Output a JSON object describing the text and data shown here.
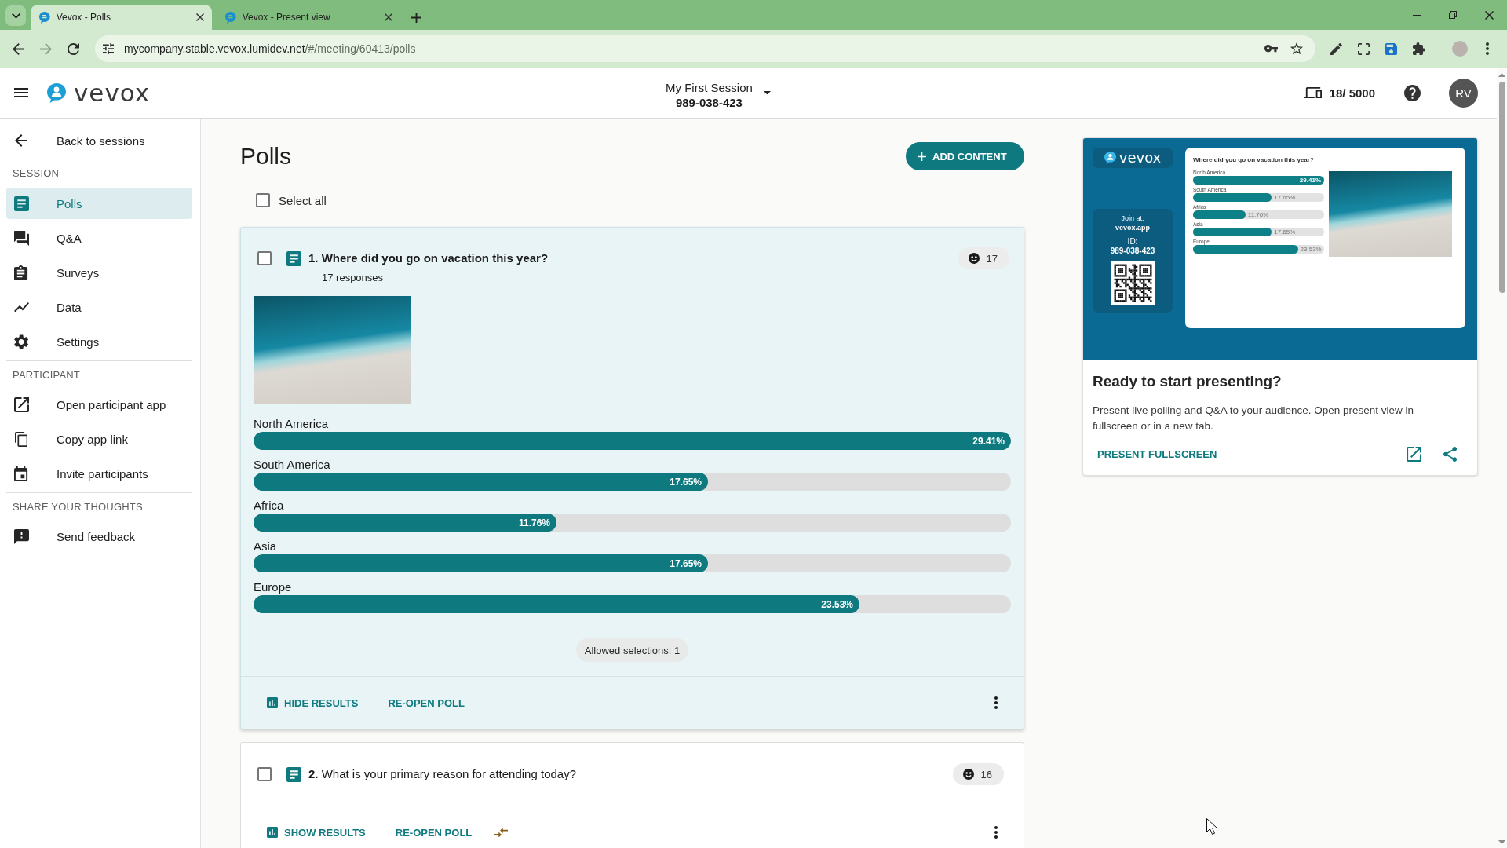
{
  "browser": {
    "tabs": [
      {
        "title": "Vevox - Polls",
        "selected": true
      },
      {
        "title": "Vevox - Present view",
        "selected": false
      }
    ],
    "address": {
      "host": "mycompany.stable.vevox.lumidev.net",
      "path": "/#/meeting/60413/polls"
    }
  },
  "header": {
    "logo": "vevox",
    "session_title": "My First Session",
    "session_id": "989-038-423",
    "participants": "18/ 5000",
    "avatar": "RV"
  },
  "sidebar": {
    "back": "Back to sessions",
    "sections": [
      {
        "heading": "SESSION",
        "items": [
          {
            "label": "Polls",
            "selected": true
          },
          {
            "label": "Q&A",
            "selected": false
          },
          {
            "label": "Surveys",
            "selected": false
          },
          {
            "label": "Data",
            "selected": false
          },
          {
            "label": "Settings",
            "selected": false
          }
        ]
      },
      {
        "heading": "PARTICIPANT",
        "items": [
          {
            "label": "Open participant app",
            "selected": false
          },
          {
            "label": "Copy app link",
            "selected": false
          },
          {
            "label": "Invite participants",
            "selected": false
          }
        ]
      },
      {
        "heading": "SHARE YOUR THOUGHTS",
        "items": [
          {
            "label": "Send feedback",
            "selected": false
          }
        ]
      }
    ]
  },
  "main": {
    "title": "Polls",
    "add_button": "ADD CONTENT",
    "select_all": {
      "label": "Select all",
      "checked": false
    },
    "polls": [
      {
        "number": "1.",
        "question": "Where did you go on vacation this year?",
        "responses": "17 responses",
        "count": "17",
        "checked": false,
        "expanded": true,
        "compare": false,
        "options": [
          {
            "label": "North America",
            "reading": "29.41%",
            "level": 1
          },
          {
            "label": "South America",
            "reading": "17.65%",
            "level": 0.6
          },
          {
            "label": "Africa",
            "reading": "11.76%",
            "level": 0.4
          },
          {
            "label": "Asia",
            "reading": "17.65%",
            "level": 0.6
          },
          {
            "label": "Europe",
            "reading": "23.53%",
            "level": 0.8
          }
        ],
        "allowed": "Allowed selections: 1",
        "actions": [
          "HIDE RESULTS",
          "RE-OPEN POLL"
        ]
      },
      {
        "number": "2.",
        "question": "What is your primary reason for attending today?",
        "count": "16",
        "checked": false,
        "expanded": false,
        "compare": true,
        "actions": [
          "SHOW RESULTS",
          "RE-OPEN POLL"
        ]
      }
    ]
  },
  "present": {
    "preview": {
      "logo": "vevox",
      "join_label": "Join at:",
      "join_url": "vevox.app",
      "id_label": "ID:",
      "id": "989-038-423",
      "question": "Where did you go on vacation this year?",
      "options": [
        {
          "label": "North America",
          "reading": "29.41%",
          "level": 1
        },
        {
          "label": "South America",
          "reading": "17.65%",
          "level": 0.6
        },
        {
          "label": "Africa",
          "reading": "11.76%",
          "level": 0.4
        },
        {
          "label": "Asia",
          "reading": "17.65%",
          "level": 0.6
        },
        {
          "label": "Europe",
          "reading": "23.53%",
          "level": 0.8
        }
      ]
    },
    "heading": "Ready to start presenting?",
    "description": "Present live polling and Q&A to your audience. Open present view in fullscreen or in a new tab.",
    "action": "PRESENT FULLSCREEN"
  }
}
